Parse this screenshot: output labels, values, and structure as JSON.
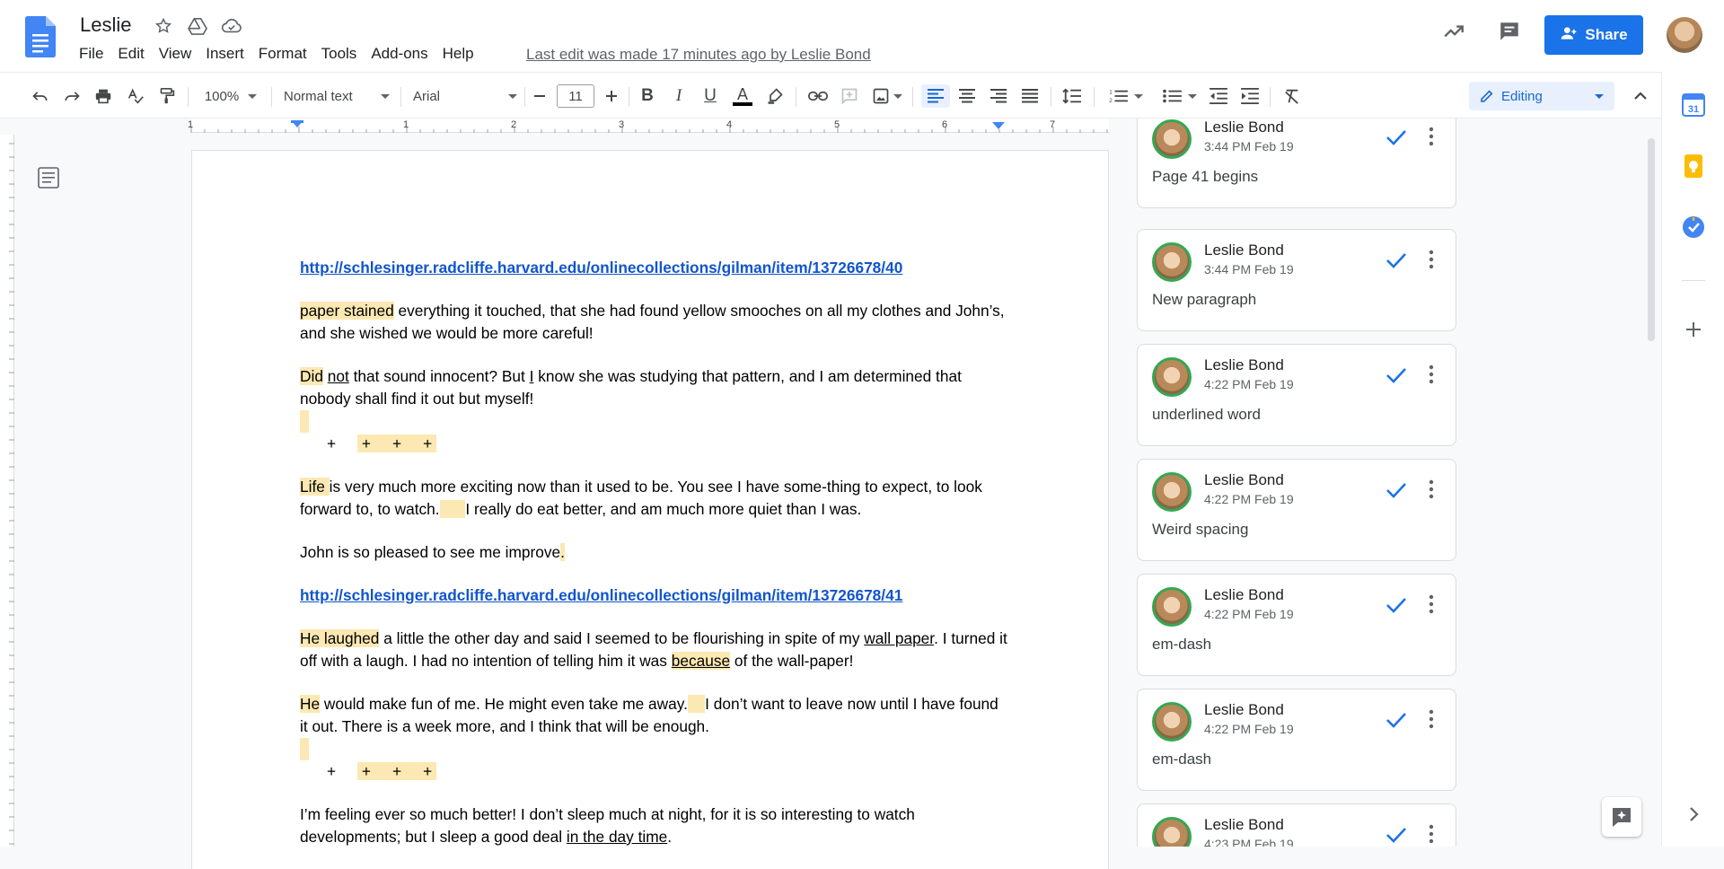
{
  "header": {
    "doc_title": "Leslie",
    "menu": [
      "File",
      "Edit",
      "View",
      "Insert",
      "Format",
      "Tools",
      "Add-ons",
      "Help"
    ],
    "last_edit": "Last edit was made 17 minutes ago by Leslie Bond",
    "share_label": "Share"
  },
  "toolbar": {
    "zoom": "100%",
    "style": "Normal text",
    "font": "Arial",
    "font_size": "11",
    "mode": "Editing"
  },
  "ruler": {
    "marks": [
      "1",
      "1",
      "2",
      "3",
      "4",
      "5",
      "6",
      "7"
    ]
  },
  "document": {
    "link1": "http://schlesinger.radcliffe.harvard.edu/onlinecollections/gilman/item/13726678/40",
    "p1a": "paper stained",
    "p1b": " everything it touched, that she had found yellow smooches on all my clothes and John’s, and she wished we would be more careful!",
    "p2a": "Did",
    "p2b": " ",
    "p2c": "not",
    "p2d": " that sound innocent? But ",
    "p2e": "I",
    "p2f": " know she was studying that pattern, and I am determined that nobody shall find it out but myself!",
    "plus1a": "+     ",
    "plus1b": " +     +     + ",
    "p3a": "Life ",
    "p3b": "is very much more exciting now than it used to be. You see I have some-thing to expect, to look forward to, to watch.",
    "p3c": "      ",
    "p3d": "I really do eat better, and am much more quiet than I was.",
    "p4a": "John is so pleased to see me improve",
    "p4b": ".",
    "link2": "http://schlesinger.radcliffe.harvard.edu/onlinecollections/gilman/item/13726678/41",
    "p5a": "He laughed",
    "p5b": " a little the other day and said I seemed to be flourishing in spite of my ",
    "p5c": "wall paper",
    "p5d": ". I turned it off with a laugh. I had no intention of telling him it was ",
    "p5e": "because",
    "p5f": " of the wall-paper!",
    "p6a": "He",
    "p6b": " would make fun of me. He might even take me away.",
    "p6c": "    ",
    "p6d": "I don’t want to leave now until I have found it out. There is a week more, and I think that will be enough.",
    "plus2a": "+     ",
    "plus2b": " +     +     + ",
    "p7a": "I’m feeling ever so much better! I don’t sleep much at night, for it is so interesting to watch developments; but I sleep a good deal ",
    "p7b": "in the day time",
    "p7c": "."
  },
  "comments": [
    {
      "name": "Leslie Bond",
      "time": "3:44 PM Feb 19",
      "text": "Page 41 begins"
    },
    {
      "name": "Leslie Bond",
      "time": "3:44 PM Feb 19",
      "text": "New paragraph"
    },
    {
      "name": "Leslie Bond",
      "time": "4:22 PM Feb 19",
      "text": "underlined word"
    },
    {
      "name": "Leslie Bond",
      "time": "4:22 PM Feb 19",
      "text": "Weird spacing"
    },
    {
      "name": "Leslie Bond",
      "time": "4:22 PM Feb 19",
      "text": "em-dash"
    },
    {
      "name": "Leslie Bond",
      "time": "4:22 PM Feb 19",
      "text": "em-dash"
    },
    {
      "name": "Leslie Bond",
      "time": "4:23 PM Feb 19",
      "text": ""
    }
  ],
  "colors": {
    "accent": "#1a73e8",
    "highlight": "#fce8b2",
    "link": "#1155cc",
    "resolve_check": "#1a73e8"
  }
}
